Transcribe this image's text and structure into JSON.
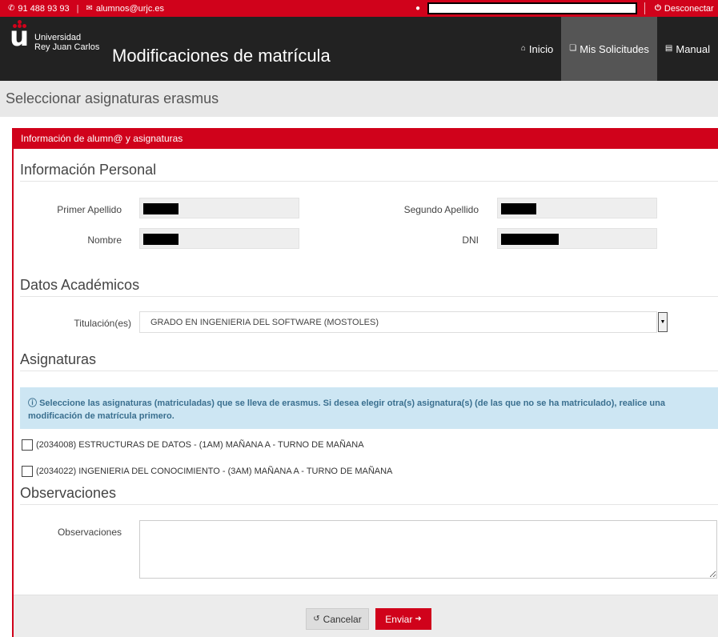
{
  "topbar": {
    "phone": "91 488 93 93",
    "email": "alumnos@urjc.es",
    "logout": "Desconectar"
  },
  "brand": {
    "logo_letter": "u",
    "university_line1": "Universidad",
    "university_line2": "Rey Juan Carlos",
    "app_title": "Modificaciones de matrícula"
  },
  "nav": {
    "home": "Inicio",
    "requests": "Mis Solicitudes",
    "manual": "Manual"
  },
  "page": {
    "subtitle": "Seleccionar asignaturas erasmus"
  },
  "panel": {
    "title": "Información de alumn@ y asignaturas",
    "personal": {
      "heading": "Información Personal",
      "first_surname_label": "Primer Apellido",
      "second_surname_label": "Segundo Apellido",
      "name_label": "Nombre",
      "dni_label": "DNI"
    },
    "academic": {
      "heading": "Datos Académicos",
      "degree_label": "Titulación(es)",
      "degree_value": "GRADO EN INGENIERIA DEL SOFTWARE (MOSTOLES)"
    },
    "subjects": {
      "heading": "Asignaturas",
      "info": "Seleccione las asignaturas (matriculadas) que se lleva de erasmus. Si desea elegir otra(s) asignatura(s) (de las que no se ha matriculado), realice una modificación de matrícula primero.",
      "items": [
        "(2034008) ESTRUCTURAS DE DATOS - (1AM) MAÑANA A - TURNO DE MAÑANA",
        "(2034022) INGENIERIA DEL CONOCIMIENTO - (3AM) MAÑANA A - TURNO DE MAÑANA"
      ]
    },
    "observations": {
      "heading": "Observaciones",
      "label": "Observaciones",
      "value": ""
    }
  },
  "actions": {
    "cancel": "Cancelar",
    "send": "Enviar"
  },
  "colors": {
    "brand_red": "#d0021b",
    "nav_dark": "#222222",
    "alert_bg": "#cde6f3"
  }
}
